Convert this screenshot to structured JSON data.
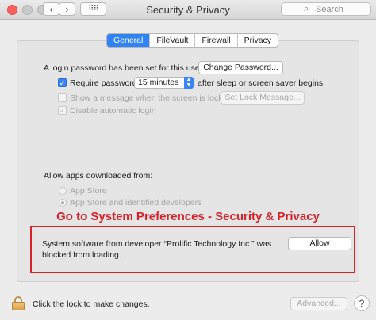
{
  "window": {
    "title": "Security & Privacy",
    "nav_back": "‹",
    "nav_forward": "›",
    "grid_icon": "⠿⠿",
    "search_placeholder": "Search"
  },
  "tabs": [
    {
      "label": "General",
      "active": true
    },
    {
      "label": "FileVault",
      "active": false
    },
    {
      "label": "Firewall",
      "active": false
    },
    {
      "label": "Privacy",
      "active": false
    }
  ],
  "general": {
    "login_password_text": "A login password has been set for this user",
    "change_password_label": "Change Password...",
    "require_password_label": "Require password",
    "require_password_checked": true,
    "require_password_delay": "15 minutes",
    "after_sleep_text": "after sleep or screen saver begins",
    "show_message_label": "Show a message when the screen is locked",
    "show_message_checked": false,
    "set_lock_message_label": "Set Lock Message...",
    "disable_autologin_label": "Disable automatic login",
    "disable_autologin_checked": true
  },
  "allow_apps": {
    "heading": "Allow apps downloaded from:",
    "options": [
      {
        "label": "App Store",
        "selected": false
      },
      {
        "label": "App Store and identified developers",
        "selected": true
      }
    ]
  },
  "annotation": {
    "caption": "Go to System Preferences - Security & Privacy",
    "color": "#d6232a"
  },
  "blocked": {
    "line1": "System software from developer “Prolific Technology Inc.” was",
    "line2": "blocked from loading.",
    "allow_label": "Allow"
  },
  "footer": {
    "lock_text": "Click the lock to make changes.",
    "advanced_label": "Advanced..."
  },
  "colors": {
    "accent": "#2f83f5",
    "window_bg": "#ececec"
  }
}
